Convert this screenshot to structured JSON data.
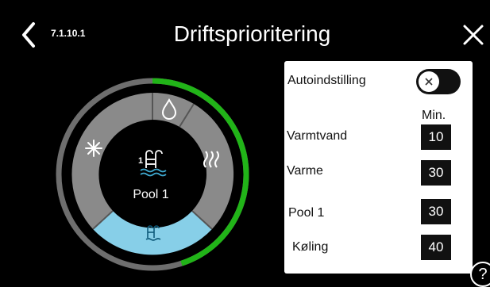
{
  "header": {
    "screen_id": "7.1.10.1",
    "title": "Driftsprioritering",
    "back_icon": "chevron-left-icon",
    "close_icon": "close-icon"
  },
  "dial": {
    "center_label": "Pool 1",
    "segments": [
      {
        "name": "hot-water",
        "icon": "water-drop-icon"
      },
      {
        "name": "heating",
        "icon": "heating-waves-icon"
      },
      {
        "name": "pool",
        "icon": "pool-ladder-icon"
      },
      {
        "name": "cooling",
        "icon": "snowflake-icon"
      }
    ],
    "center_icon": "pool-1-icon",
    "progress_fraction": 0.45,
    "colors": {
      "ring": "#6e6e6e",
      "progress": "#21b418",
      "segment": "#8a8a8a",
      "active_segment": "#87cfe8",
      "center": "#000000"
    }
  },
  "panel": {
    "auto_label": "Autoindstilling",
    "auto_toggle_icon": "close-icon",
    "min_label": "Min.",
    "rows": [
      {
        "label": "Varmtvand",
        "value": "10"
      },
      {
        "label": "Varme",
        "value": "30"
      },
      {
        "label": "Pool 1",
        "value": "30"
      },
      {
        "label": "Køling",
        "value": "40"
      }
    ]
  },
  "help": {
    "label": "?"
  }
}
